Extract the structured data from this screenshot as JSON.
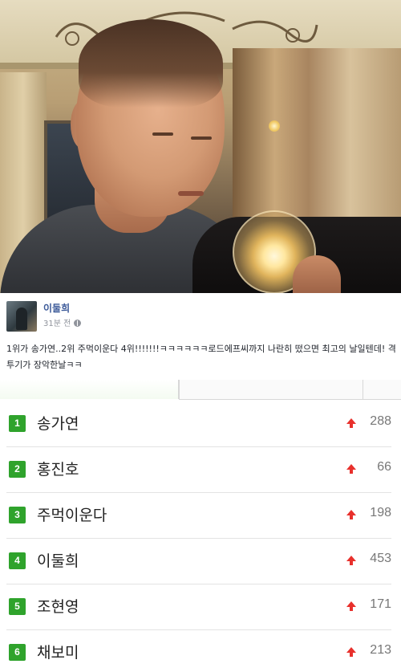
{
  "post": {
    "author": "이둘희",
    "time": "31분 전",
    "text": "1위가 송가연..2위 주먹이운다 4위!!!!!!!ㅋㅋㅋㅋㅋㅋ로드에프씨까지 나란히 떴으면 최고의 날일텐데! 격투기가 장악한날ㅋㅋ"
  },
  "ranking": {
    "items": [
      {
        "rank": "1",
        "name": "송가연",
        "change": "288"
      },
      {
        "rank": "2",
        "name": "홍진호",
        "change": "66"
      },
      {
        "rank": "3",
        "name": "주먹이운다",
        "change": "198"
      },
      {
        "rank": "4",
        "name": "이둘희",
        "change": "453"
      },
      {
        "rank": "5",
        "name": "조현영",
        "change": "171"
      },
      {
        "rank": "6",
        "name": "채보미",
        "change": "213"
      }
    ]
  }
}
